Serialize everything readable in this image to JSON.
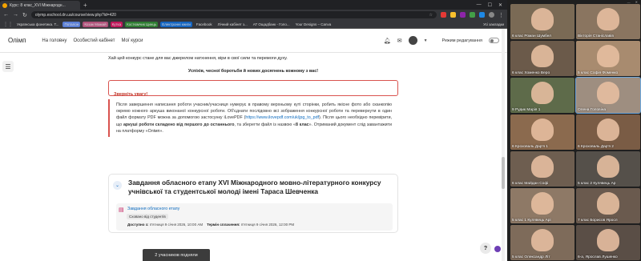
{
  "browser": {
    "tab_title": "Курс: 8 клас_XVI Міжнародн...",
    "url": "olymp.eschool.dn.ua/course/view.php?id=420",
    "bookmarks": [
      "Українська фонетика. Т...",
      "Поталон",
      "Козак Мамай",
      "Кутка",
      "Костюмчик Цинць",
      "Електронні книги",
      "Facebook",
      "Лічний кабінет з...",
      "AT Ощадбанк - Голо...",
      "Your Designs – Canva"
    ],
    "all_bookmarks": "Усі закладки"
  },
  "site": {
    "brand": "Олімп",
    "nav": [
      "На головну",
      "Особистий кабінет",
      "Мої курси"
    ],
    "edit_mode_label": "Режим редагування"
  },
  "content": {
    "intro_line": "Хай цей конкурс стане для вас джерелом натхнення, віри в свої сили та перемоги духу.",
    "success_line": "Успіхів, чесної боротьби й нових досягнень кожному з вас!",
    "alert_title": "Зверніть увагу!",
    "notice_part1": "Після завершення написання роботи учасник/учасниця нумерує в правому верхньому куті сторінки, робить якісне фото або сканкопію окремо кожного аркуша виконаної конкурсної роботи. Об'єднати послідовно всі зображення конкурсної роботи та перевернути в один файл формату PDF можна за допомогою застосунку iLovePDF (",
    "notice_link": "https://www.ilovepdf.com/uk/jpg_to_pdf",
    "notice_part2": "). Після цього необхідно перевірити, що ",
    "notice_bold1": "аркуші роботи складено від першого до останнього",
    "notice_part3": ", та зберегти файл із назвою «",
    "notice_bold2": "8 клас",
    "notice_part4": "». Отриманий документ слід завантажити на платформу «Олімп»."
  },
  "section": {
    "title": "Завдання обласного етапу XVI Міжнародного мовно-літературного конкурсу учнівської та студентської молоді імені Тараса Шевченка",
    "activity_link": "Завдання обласного етапу",
    "activity_badge": "Сховано від студентів",
    "available_label": "Доступно з:",
    "available_value": "п'ятниця 9 січня 2026, 10:00 AM",
    "due_label": "Термін сплачення:",
    "due_value": "п'ятниця 9 січня 2026, 12:00 PM"
  },
  "toast": "2 учасников подняли",
  "participants": [
    {
      "name": "6 клас Роман Шумбел",
      "color": "#7a6a55"
    },
    {
      "name": "Вікторія Станіславів",
      "color": "#8a7560"
    },
    {
      "name": "6 клас Хоменко Веро",
      "color": "#6b5a4a"
    },
    {
      "name": "5 клас Софія Фоменко",
      "color": "#a88b6f"
    },
    {
      "name": "9 Рудик Марія 1",
      "color": "#5e6b4a"
    },
    {
      "name": "Олена Головіна",
      "color": "#9e8e80"
    },
    {
      "name": "6 Кроховаль Дар'я 1",
      "color": "#8b6a4e"
    },
    {
      "name": "6 Кроховаль Дар'я 2",
      "color": "#7a5c45"
    },
    {
      "name": "6 клас Майдан Софі",
      "color": "#6e5e50"
    },
    {
      "name": "5 клас 2 Кулявець Ар",
      "color": "#55504a"
    },
    {
      "name": "5 клас 1 Кулявець Арі",
      "color": "#8e7966"
    },
    {
      "name": "7 клас Борисов Яросл",
      "color": "#6a5a4e"
    },
    {
      "name": "5 клас Олександр Літ",
      "color": "#7e6b5a"
    },
    {
      "name": "6-а, Ярослав Лушенко",
      "color": "#5a4e46"
    }
  ]
}
